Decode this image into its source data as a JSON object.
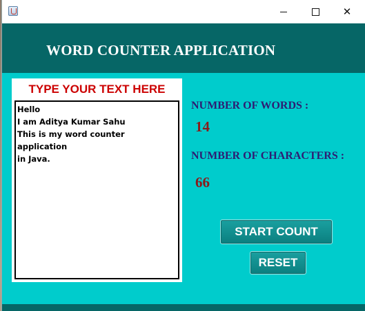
{
  "window": {
    "minimize_glyph": "",
    "maximize_glyph": "",
    "close_glyph": "✕"
  },
  "header": {
    "title": "WORD COUNTER APPLICATION"
  },
  "text_panel": {
    "title": "TYPE YOUR TEXT HERE",
    "content": "Hello\nI am Aditya Kumar Sahu\nThis is my word counter application\nin Java."
  },
  "stats": {
    "words_label": "NUMBER OF WORDS :",
    "words_value": "14",
    "chars_label": "NUMBER OF CHARACTERS :",
    "chars_value": "66"
  },
  "buttons": {
    "start_label": "START COUNT",
    "reset_label": "RESET"
  },
  "colors": {
    "background": "#00cccc",
    "header": "#066666",
    "panel_title": "#cc0000",
    "label": "#2e1d73",
    "value": "#8b1a1a",
    "button": "#0b8f8f"
  }
}
